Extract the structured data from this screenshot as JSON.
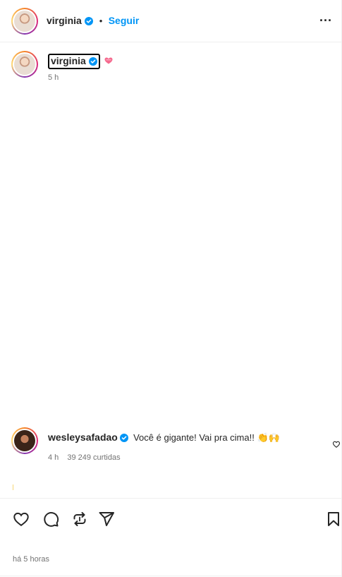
{
  "header": {
    "username": "virginia",
    "separator": "•",
    "follow_label": "Seguir",
    "more_label": "..."
  },
  "caption": {
    "username": "virginia",
    "time": "5 h"
  },
  "comment": {
    "username": "wesleysafadao",
    "text": "Você é gigante! Vai pra cima!! 👏🙌",
    "time": "4 h",
    "likes": "39 249 curtidas"
  },
  "footer": {
    "date": "há 5 horas"
  },
  "icons": {
    "verified": "verified-badge-icon",
    "heart_emoji": "heart-emoji-icon",
    "like": "heart-icon",
    "comment": "comment-icon",
    "repost": "repost-icon",
    "share": "send-icon",
    "save": "bookmark-icon",
    "comment_like": "heart-outline-icon"
  },
  "colors": {
    "verified": "#0095f6",
    "link": "#0095f6",
    "muted": "#737373",
    "text": "#262626"
  }
}
